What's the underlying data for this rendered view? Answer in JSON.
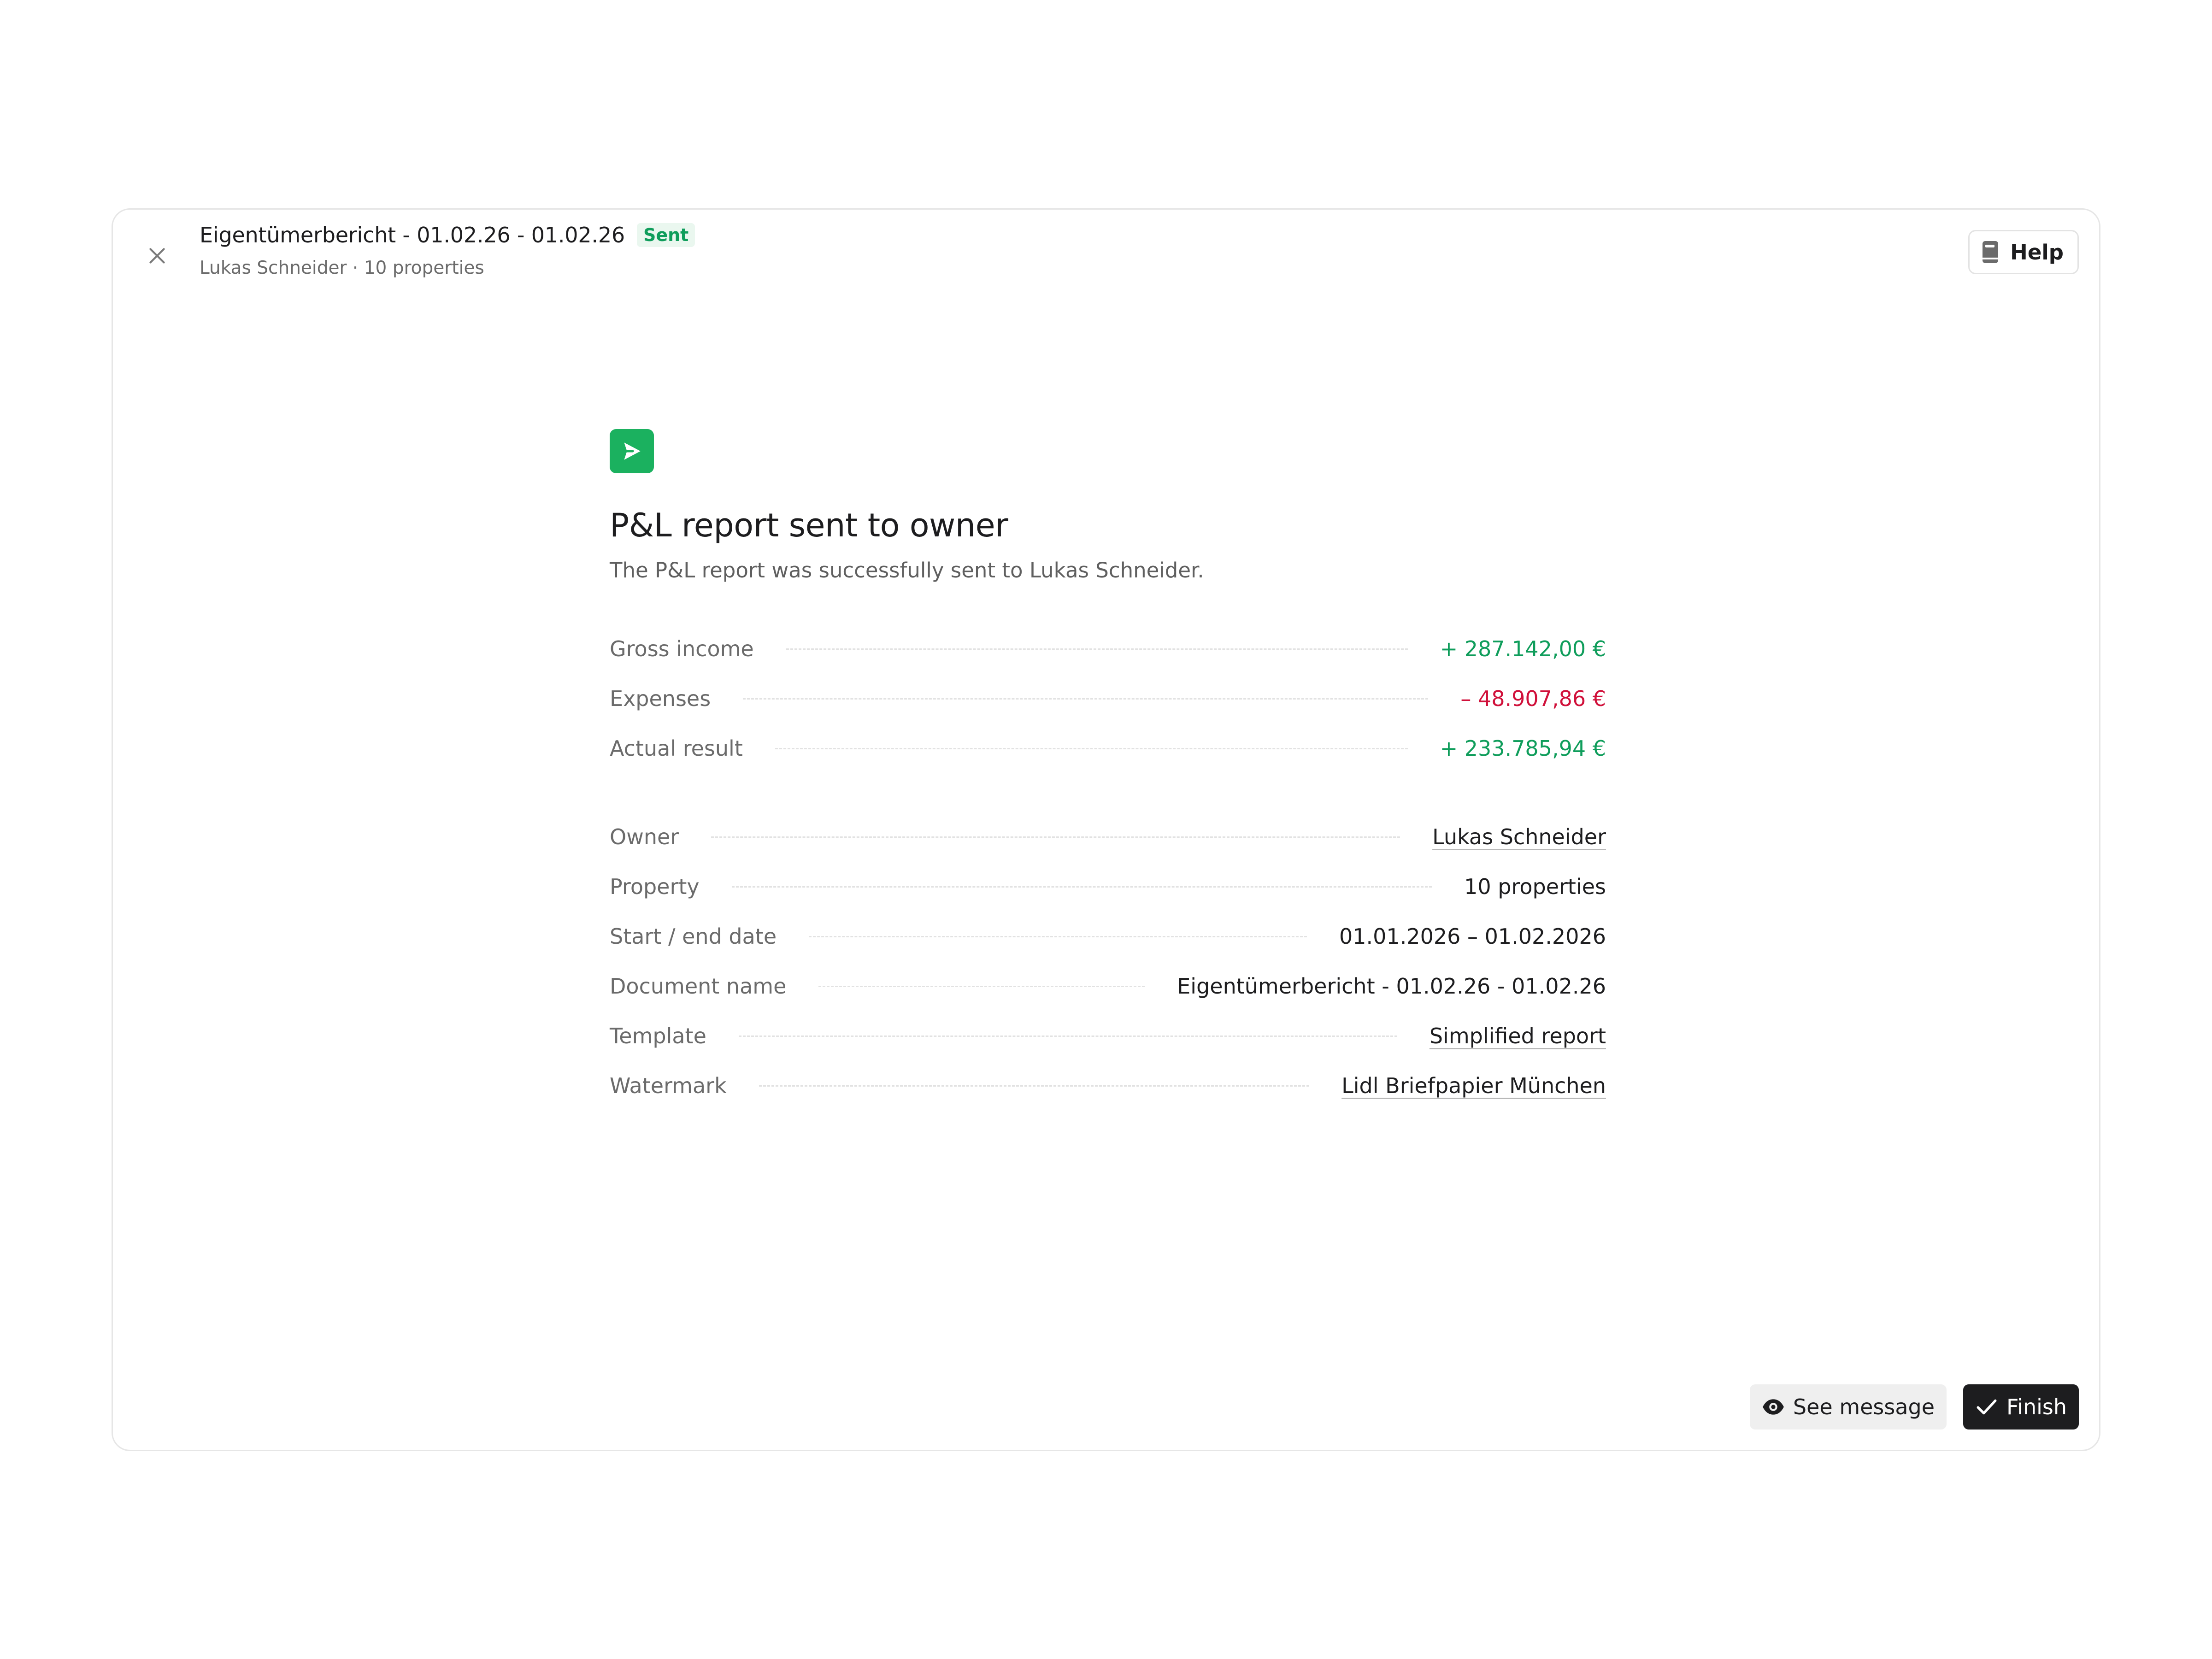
{
  "header": {
    "title": "Eigentümerbericht - 01.02.26 - 01.02.26",
    "status_badge": "Sent",
    "subtitle": "Lukas Schneider · 10 properties",
    "help_label": "Help",
    "close_icon": "close-icon",
    "help_icon": "book-icon"
  },
  "main": {
    "icon": "send-icon",
    "heading": "P&L report sent to owner",
    "description": "The P&L report was successfully sent to Lukas Schneider.",
    "financials": [
      {
        "label": "Gross income",
        "value": "+ 287.142,00 €",
        "tone": "positive"
      },
      {
        "label": "Expenses",
        "value": "– 48.907,86 €",
        "tone": "negative"
      },
      {
        "label": "Actual result",
        "value": "+ 233.785,94 €",
        "tone": "positive"
      }
    ],
    "details": [
      {
        "label": "Owner",
        "value": "Lukas Schneider",
        "link": true
      },
      {
        "label": "Property",
        "value": "10 properties",
        "link": false
      },
      {
        "label": "Start / end date",
        "value": "01.01.2026 – 01.02.2026",
        "link": false
      },
      {
        "label": "Document name",
        "value": "Eigentümerbericht - 01.02.26 - 01.02.26",
        "link": false
      },
      {
        "label": "Template",
        "value": "Simplified report",
        "link": true
      },
      {
        "label": "Watermark",
        "value": "Lidl Briefpapier München",
        "link": true
      }
    ]
  },
  "footer": {
    "see_message_label": "See message",
    "finish_label": "Finish",
    "see_message_icon": "eye-icon",
    "finish_icon": "check-icon"
  },
  "colors": {
    "positive": "#0f9d5b",
    "negative": "#d0103a",
    "accent_green": "#1bb15f",
    "primary_button": "#1d1d1f"
  }
}
